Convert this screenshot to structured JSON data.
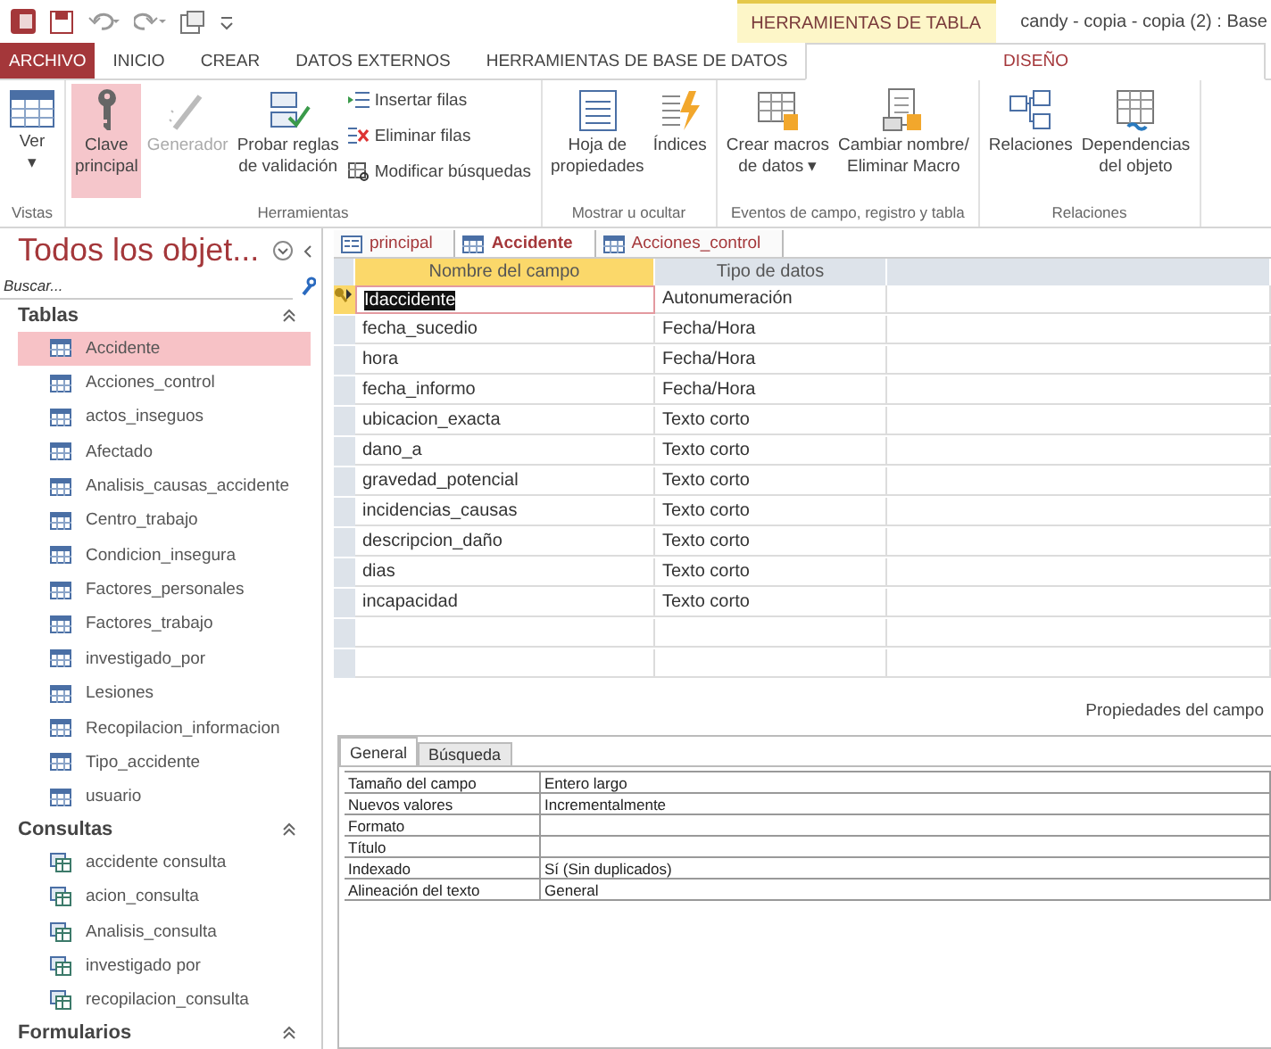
{
  "titlebar": {
    "context_tab": "HERRAMIENTAS DE TABLA",
    "title": "candy - copia - copia (2) : Base"
  },
  "ribbon_tabs": [
    {
      "label": "ARCHIVO",
      "kind": "file",
      "selected": false
    },
    {
      "label": "INICIO",
      "kind": "tab",
      "selected": false
    },
    {
      "label": "CREAR",
      "kind": "tab",
      "selected": false
    },
    {
      "label": "DATOS EXTERNOS",
      "kind": "tab",
      "selected": false
    },
    {
      "label": "HERRAMIENTAS DE BASE DE DATOS",
      "kind": "tab",
      "selected": false
    },
    {
      "label": "DISEÑO",
      "kind": "tab",
      "selected": true
    }
  ],
  "ribbon_groups": [
    {
      "label": "Vistas",
      "buttons": [
        {
          "lines": [
            "Ver",
            "▾"
          ],
          "kind": "large",
          "selected": false,
          "disabled": false
        }
      ]
    },
    {
      "label": "Herramientas",
      "buttons": [
        {
          "lines": [
            "Clave",
            "principal"
          ],
          "kind": "large",
          "selected": true,
          "disabled": false
        },
        {
          "lines": [
            "Generador"
          ],
          "kind": "large",
          "selected": false,
          "disabled": true
        },
        {
          "lines": [
            "Probar reglas",
            "de validación"
          ],
          "kind": "large",
          "selected": false,
          "disabled": false
        },
        {
          "lines": [
            "Insertar filas"
          ],
          "kind": "small",
          "selected": false,
          "disabled": false
        },
        {
          "lines": [
            "Eliminar filas"
          ],
          "kind": "small",
          "selected": false,
          "disabled": false
        },
        {
          "lines": [
            "Modificar búsquedas"
          ],
          "kind": "small",
          "selected": false,
          "disabled": false
        }
      ]
    },
    {
      "label": "Mostrar u ocultar",
      "buttons": [
        {
          "lines": [
            "Hoja de",
            "propiedades"
          ],
          "kind": "large",
          "selected": false,
          "disabled": false
        },
        {
          "lines": [
            "Índices"
          ],
          "kind": "large",
          "selected": false,
          "disabled": false
        }
      ]
    },
    {
      "label": "Eventos de campo, registro y tabla",
      "buttons": [
        {
          "lines": [
            "Crear macros",
            "de datos ▾"
          ],
          "kind": "large",
          "selected": false,
          "disabled": false
        },
        {
          "lines": [
            "Cambiar nombre/",
            "Eliminar Macro"
          ],
          "kind": "large",
          "selected": false,
          "disabled": false
        }
      ]
    },
    {
      "label": "Relaciones",
      "buttons": [
        {
          "lines": [
            "Relaciones"
          ],
          "kind": "large",
          "selected": false,
          "disabled": false
        },
        {
          "lines": [
            "Dependencias",
            "del objeto"
          ],
          "kind": "large",
          "selected": false,
          "disabled": false
        }
      ]
    }
  ],
  "nav": {
    "title": "Todos los objet...",
    "search": {
      "placeholder": "Buscar..."
    },
    "sections": [
      {
        "label": "Tablas",
        "kind": "table",
        "items": [
          {
            "label": "Accidente",
            "selected": true
          },
          {
            "label": "Acciones_control",
            "selected": false
          },
          {
            "label": "actos_inseguos",
            "selected": false
          },
          {
            "label": "Afectado",
            "selected": false
          },
          {
            "label": "Analisis_causas_accidente",
            "selected": false
          },
          {
            "label": "Centro_trabajo",
            "selected": false
          },
          {
            "label": "Condicion_insegura",
            "selected": false
          },
          {
            "label": "Factores_personales",
            "selected": false
          },
          {
            "label": "Factores_trabajo",
            "selected": false
          },
          {
            "label": "investigado_por",
            "selected": false
          },
          {
            "label": "Lesiones",
            "selected": false
          },
          {
            "label": "Recopilacion_informacion",
            "selected": false
          },
          {
            "label": "Tipo_accidente",
            "selected": false
          },
          {
            "label": "usuario",
            "selected": false
          }
        ]
      },
      {
        "label": "Consultas",
        "kind": "query",
        "items": [
          {
            "label": "accidente consulta",
            "selected": false
          },
          {
            "label": "acion_consulta",
            "selected": false
          },
          {
            "label": "Analisis_consulta",
            "selected": false
          },
          {
            "label": "investigado por",
            "selected": false
          },
          {
            "label": "recopilacion_consulta",
            "selected": false
          }
        ]
      },
      {
        "label": "Formularios"
      }
    ]
  },
  "doc_tabs": [
    {
      "label": "principal",
      "kind": "form",
      "selected": false
    },
    {
      "label": "Accidente",
      "kind": "table",
      "selected": true
    },
    {
      "label": "Acciones_control",
      "kind": "table",
      "selected": false
    }
  ],
  "design_grid": {
    "columns": [
      "Nombre del campo",
      "Tipo de datos"
    ],
    "rows": [
      {
        "field": "Idaccidente",
        "type": "Autonumeración",
        "primary_key": true,
        "selected": true
      },
      {
        "field": "fecha_sucedio",
        "type": "Fecha/Hora",
        "primary_key": false,
        "selected": false
      },
      {
        "field": "hora",
        "type": "Fecha/Hora",
        "primary_key": false,
        "selected": false
      },
      {
        "field": "fecha_informo",
        "type": "Fecha/Hora",
        "primary_key": false,
        "selected": false
      },
      {
        "field": "ubicacion_exacta",
        "type": "Texto corto",
        "primary_key": false,
        "selected": false
      },
      {
        "field": "dano_a",
        "type": "Texto corto",
        "primary_key": false,
        "selected": false
      },
      {
        "field": "gravedad_potencial",
        "type": "Texto corto",
        "primary_key": false,
        "selected": false
      },
      {
        "field": "incidencias_causas",
        "type": "Texto corto",
        "primary_key": false,
        "selected": false
      },
      {
        "field": "descripcion_daño",
        "type": "Texto corto",
        "primary_key": false,
        "selected": false
      },
      {
        "field": "dias",
        "type": "Texto corto",
        "primary_key": false,
        "selected": false
      },
      {
        "field": "incapacidad",
        "type": "Texto corto",
        "primary_key": false,
        "selected": false
      }
    ]
  },
  "properties": {
    "title": "Propiedades del campo",
    "tabs": [
      {
        "label": "General",
        "selected": true
      },
      {
        "label": "Búsqueda",
        "selected": false
      }
    ],
    "rows": [
      {
        "name": "Tamaño del campo",
        "value": "Entero largo"
      },
      {
        "name": "Nuevos valores",
        "value": "Incrementalmente"
      },
      {
        "name": "Formato"
      },
      {
        "name": "Título"
      },
      {
        "name": "Indexado",
        "value": "Sí (Sin duplicados)"
      },
      {
        "name": "Alineación del texto",
        "value": "General"
      }
    ]
  }
}
